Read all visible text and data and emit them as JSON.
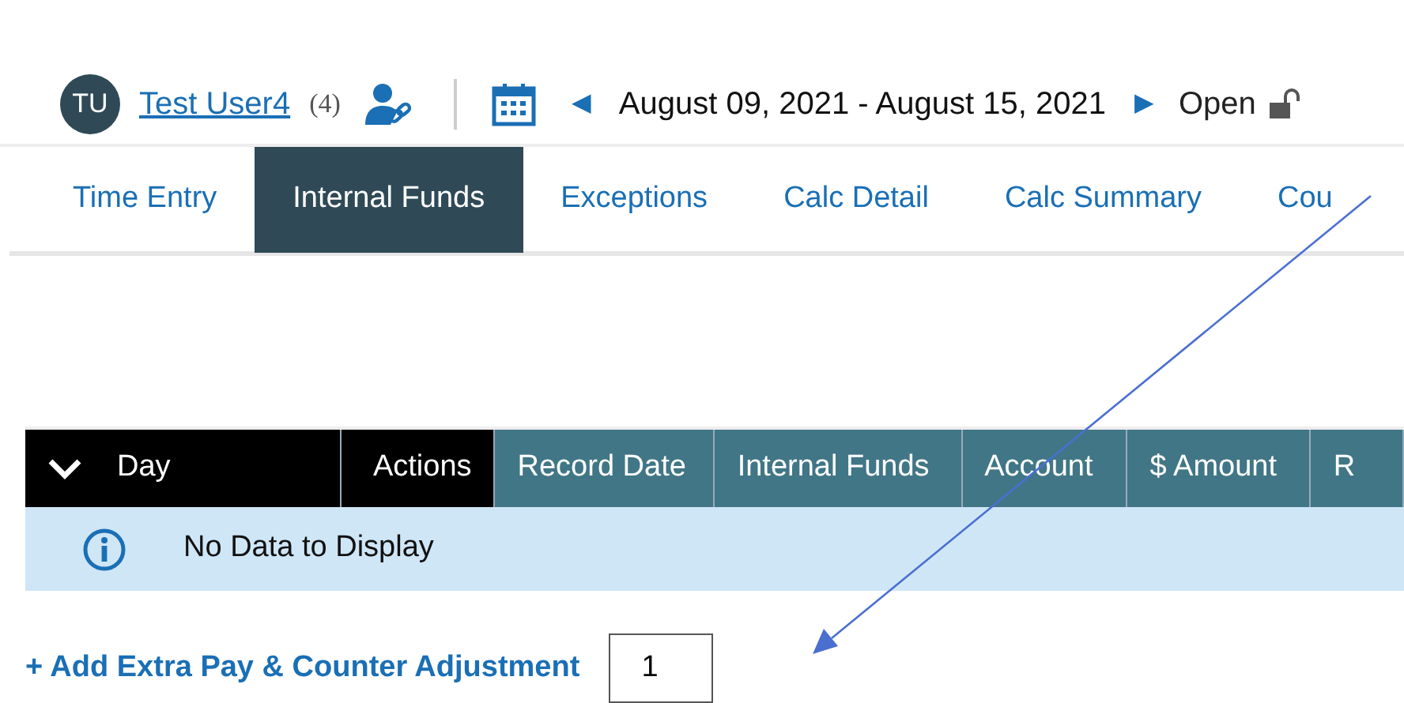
{
  "user": {
    "initials": "TU",
    "name": "Test User4",
    "count": "(4)"
  },
  "period": {
    "prev": "◀",
    "range": "August 09, 2021 - August 15, 2021",
    "next": "▶",
    "status": "Open",
    "locked": false
  },
  "tabs": [
    {
      "label": "Time Entry",
      "selected": false
    },
    {
      "label": "Internal Funds",
      "selected": true
    },
    {
      "label": "Exceptions",
      "selected": false
    },
    {
      "label": "Calc Detail",
      "selected": false
    },
    {
      "label": "Calc Summary",
      "selected": false
    },
    {
      "label": "Cou",
      "selected": false
    }
  ],
  "table": {
    "columns": [
      {
        "label": "Day",
        "kind": "group"
      },
      {
        "label": "Actions",
        "kind": "actions"
      },
      {
        "label": "Record Date",
        "kind": "data"
      },
      {
        "label": "Internal Funds",
        "kind": "data"
      },
      {
        "label": "Account",
        "kind": "data"
      },
      {
        "label": "$ Amount",
        "kind": "data"
      },
      {
        "label": "R",
        "kind": "data"
      }
    ],
    "empty_message": "No Data to Display"
  },
  "add_link": {
    "plus": "+",
    "label": "Add Extra Pay & Counter Adjustment"
  },
  "count_field": {
    "value": "1"
  },
  "annotation": {
    "kind": "arrow"
  }
}
